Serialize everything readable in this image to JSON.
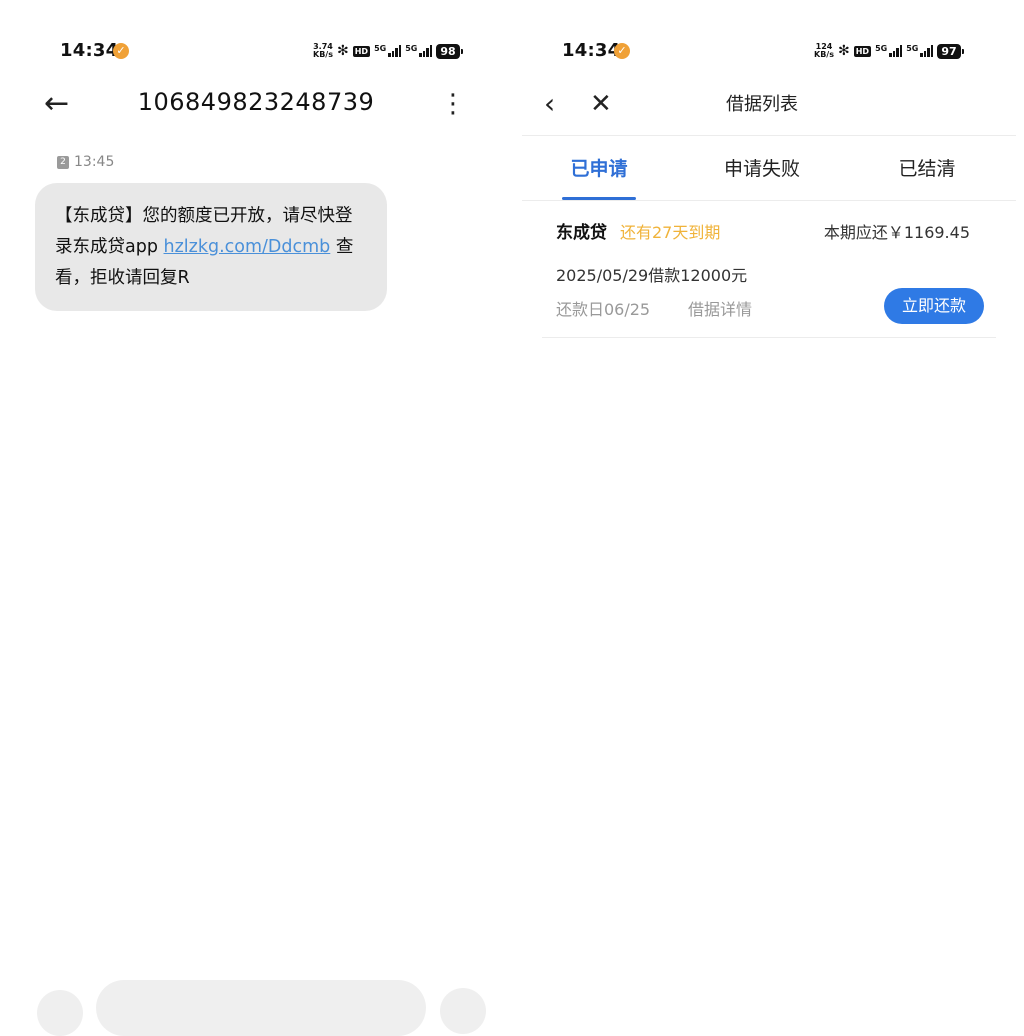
{
  "left": {
    "status": {
      "time": "14:34",
      "netspeed_top": "3.74",
      "netspeed_bottom": "KB/s",
      "hd": "HD",
      "sig1": "5G",
      "sig2": "5G",
      "battery": "98"
    },
    "header": {
      "sender": "106849823248739"
    },
    "message": {
      "sim": "2",
      "time": "13:45",
      "text_before_link": "【东成贷】您的额度已开放，请尽快登录东成贷app ",
      "link_text": "hzlzkg.com/Ddcmb",
      "text_after_link": " 查看，拒收请回复R"
    }
  },
  "right": {
    "status": {
      "time": "14:34",
      "netspeed_top": "124",
      "netspeed_bottom": "KB/s",
      "hd": "HD",
      "sig1": "5G",
      "sig2": "5G",
      "battery": "97"
    },
    "nav": {
      "title": "借据列表"
    },
    "tabs": [
      {
        "label": "已申请"
      },
      {
        "label": "申请失败"
      },
      {
        "label": "已结清"
      }
    ],
    "loan": {
      "lender": "东成贷",
      "due_tag": "还有27天到期",
      "amount_due": "本期应还￥1169.45",
      "loan_info": "2025/05/29借款12000元",
      "repay_day": "还款日06/25",
      "detail_link": "借据详情",
      "repay_button": "立即还款"
    }
  },
  "colors": {
    "accent": "#2f6fd6",
    "button": "#2f7ae5",
    "warning": "#f0b33a",
    "bubble": "#e8e8e8",
    "link": "#4a90d9"
  }
}
